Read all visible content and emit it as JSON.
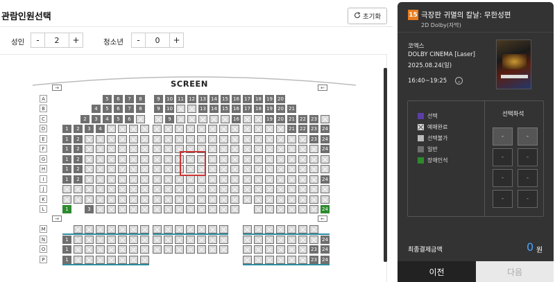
{
  "header": {
    "title": "관람인원선택",
    "reset_label": "초기화"
  },
  "counts": {
    "adult": {
      "label": "성인",
      "value": "2",
      "minus": "-",
      "plus": "+"
    },
    "youth": {
      "label": "청소년",
      "value": "0",
      "minus": "-",
      "plus": "+"
    }
  },
  "screen_label": "SCREEN",
  "row_labels_top": [
    "A",
    "B",
    "C",
    "D",
    "E",
    "F",
    "G",
    "H",
    "I",
    "J",
    "K",
    "L"
  ],
  "row_labels_bottom": [
    "M",
    "N",
    "O",
    "P"
  ],
  "seat_rows": {
    "A": {
      "left": [],
      "center": [
        "5",
        "6",
        "7",
        "8",
        "9",
        "10",
        "11",
        "12",
        "13",
        "14",
        "15",
        "16"
      ],
      "right": [
        "17",
        "18",
        "19",
        "20"
      ]
    },
    "B": {
      "left": [],
      "center": [
        "4",
        "5",
        "6",
        "7",
        "8",
        "9",
        "10",
        "",
        "",
        "13",
        "14",
        "15",
        "16"
      ],
      "right": [
        "17",
        "18",
        "19",
        "20",
        "21"
      ]
    },
    "C": {
      "left": [],
      "center": [
        "2",
        "3",
        "4",
        "5",
        "6",
        "",
        "",
        "9",
        "",
        "",
        "",
        "",
        "",
        "16"
      ],
      "right": [
        "",
        "",
        "19",
        "20",
        "21",
        "22",
        "23"
      ]
    },
    "D": {
      "left": [
        "1",
        "2",
        "3",
        "4"
      ],
      "right": [
        "21",
        "22",
        "23",
        "24"
      ]
    },
    "E": {
      "left": [
        "1",
        "2"
      ],
      "right": [
        "23",
        "24"
      ]
    },
    "F": {
      "left": [
        "1",
        "2"
      ],
      "right": [
        "24"
      ]
    },
    "G": {
      "left": [
        "1",
        "2"
      ],
      "right": []
    },
    "H": {
      "left": [
        "1",
        "2"
      ],
      "right": []
    },
    "I": {
      "left": [
        "1",
        "2"
      ],
      "right": [
        "24"
      ]
    },
    "J": {
      "left": [],
      "right": []
    },
    "K": {
      "left": [],
      "right": []
    },
    "L": {
      "left": [
        "1",
        "3"
      ],
      "right": [
        "24"
      ]
    },
    "N": {
      "left": [
        "1"
      ],
      "right": [
        "24"
      ]
    },
    "O": {
      "left": [
        "1"
      ],
      "right": [
        "23",
        "24"
      ]
    },
    "P": {
      "left": [
        "1"
      ],
      "right": [
        "23",
        "24"
      ]
    }
  },
  "movie": {
    "age_rating": "15",
    "title": "극장판 귀멸의 칼날: 무한성편",
    "format": "2D Dolby(자막)",
    "theater": "코엑스",
    "screen": "DOLBY CINEMA [Laser]",
    "date": "2025.08.24(일)",
    "time": "16:40~19:25"
  },
  "legend": [
    {
      "label": "선택",
      "color": "#5b3fa8"
    },
    {
      "label": "예매완료",
      "color": "#d8d8d8"
    },
    {
      "label": "선택불가",
      "color": "#bbbbbb"
    },
    {
      "label": "일반",
      "color": "#6f6f6f"
    },
    {
      "label": "장애인석",
      "color": "#2d8a2d"
    }
  ],
  "selected_seats": {
    "title": "선택좌석",
    "slots": [
      "-",
      "-",
      "-",
      "-",
      "-",
      "-",
      "-",
      "-"
    ]
  },
  "total": {
    "label": "최종결제금액",
    "value": "0",
    "unit": "원"
  },
  "buttons": {
    "prev": "이전",
    "next": "다음"
  },
  "icons": {
    "reset": "refresh-icon",
    "time_toggle": "chevron-down-icon",
    "exit_marker": "exit-arrow-icon"
  }
}
